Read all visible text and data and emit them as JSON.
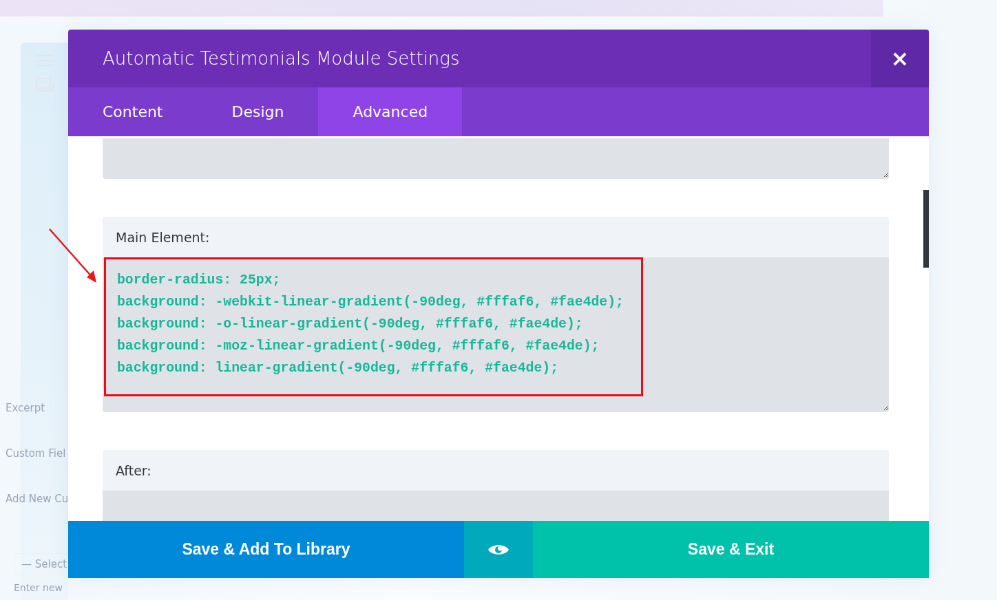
{
  "background": {
    "fields": [
      {
        "kind": "label",
        "text": "Excerpt"
      },
      {
        "kind": "label",
        "text": "Custom Fiel"
      },
      {
        "kind": "label",
        "text": "Add New Cu"
      },
      {
        "kind": "select",
        "text": "— Select"
      },
      {
        "kind": "hint",
        "text": "Enter new"
      }
    ]
  },
  "modal": {
    "title": "Automatic Testimonials Module Settings",
    "close": "×",
    "tabs": [
      {
        "label": "Content",
        "selected": false
      },
      {
        "label": "Design",
        "selected": false
      },
      {
        "label": "Advanced",
        "selected": true
      }
    ],
    "sections": [
      {
        "kind": "textarea"
      },
      {
        "kind": "code",
        "label": "Main Element:",
        "lines": [
          "border-radius: 25px;",
          "background: -webkit-linear-gradient(-90deg, #fffaf6, #fae4de);",
          "background: -o-linear-gradient(-90deg, #fffaf6, #fae4de);",
          "background: -moz-linear-gradient(-90deg, #fffaf6, #fae4de);",
          "background: linear-gradient(-90deg, #fffaf6, #fae4de);"
        ]
      },
      {
        "kind": "label",
        "label": "After:"
      }
    ],
    "footer": [
      {
        "kind": "library",
        "label": "Save & Add To Library"
      },
      {
        "kind": "preview"
      },
      {
        "kind": "exit",
        "label": "Save & Exit"
      }
    ]
  }
}
